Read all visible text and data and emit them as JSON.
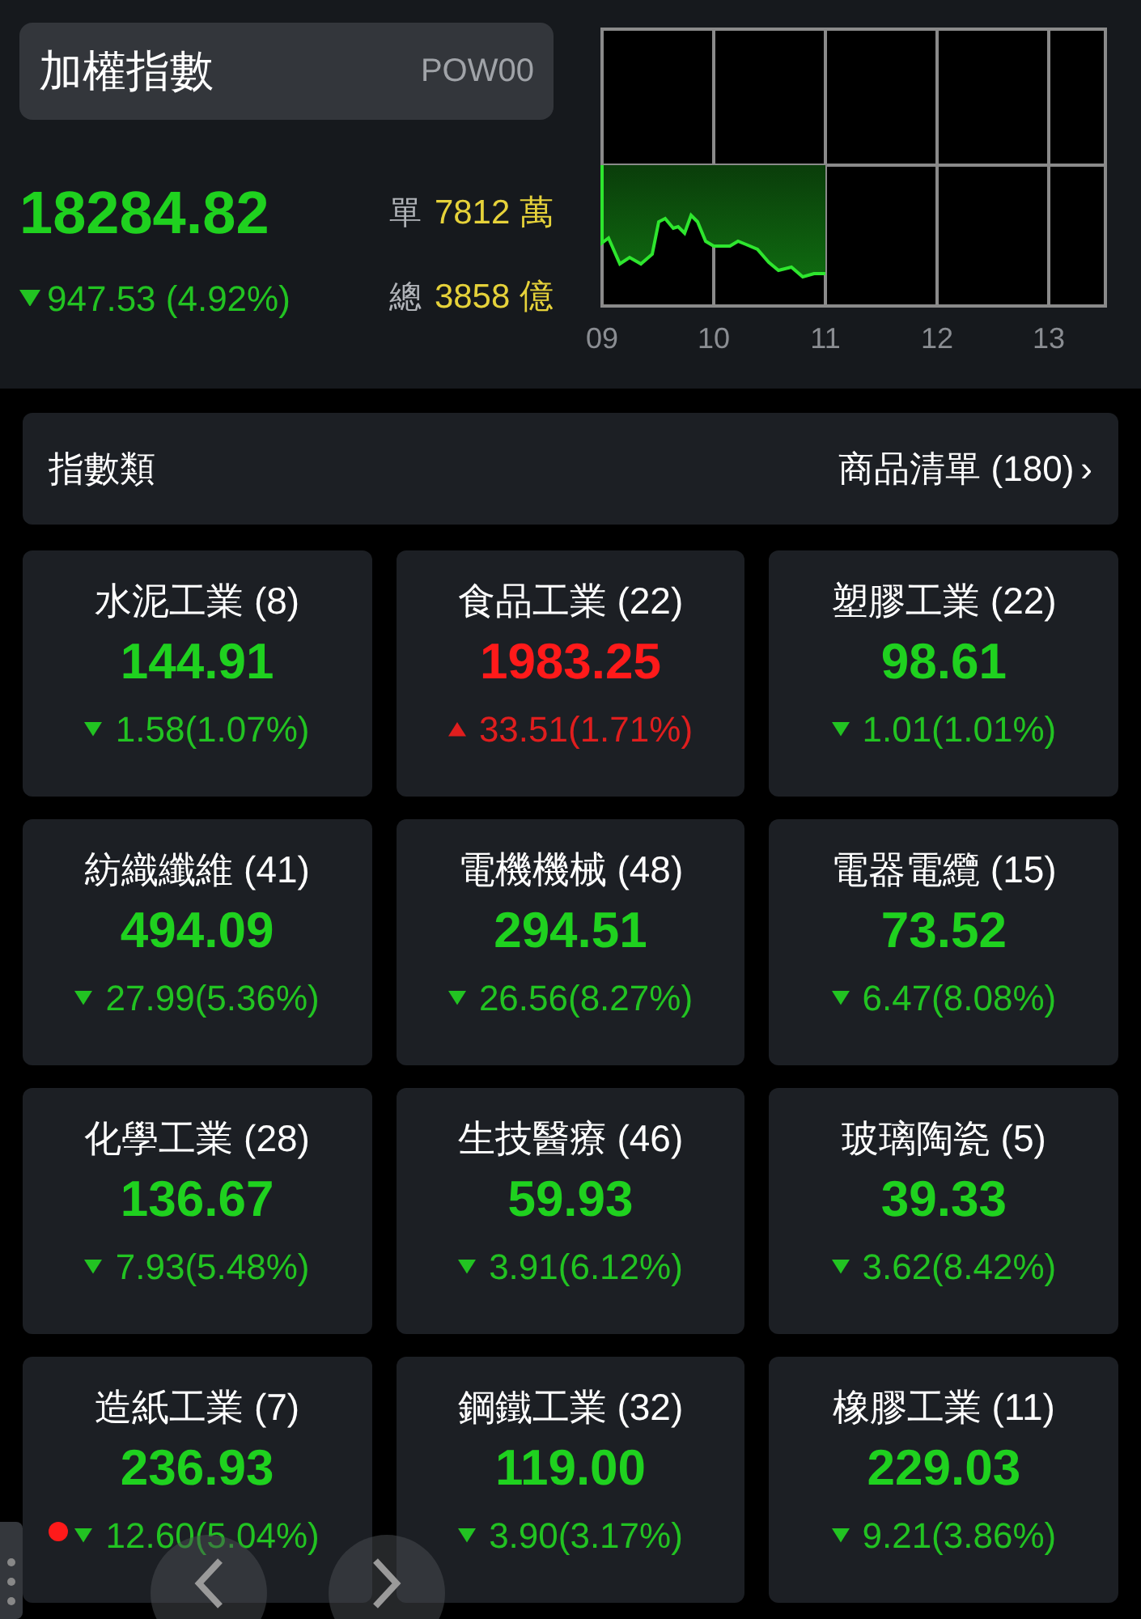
{
  "index": {
    "name": "加權指數",
    "code": "POW00",
    "price": "18284.82",
    "kind": "down",
    "change": "947.53 (4.92%)",
    "volume_label": "單",
    "volume": "7812 萬",
    "total_label": "總",
    "total": "3858 億"
  },
  "chart": {
    "time_labels": [
      "09",
      "10",
      "11",
      "12",
      "13"
    ]
  },
  "section": {
    "title": "指數類",
    "link": "商品清單 (180)",
    "link_icon": "›"
  },
  "sectors": [
    {
      "name": "水泥工業 (8)",
      "price": "144.91",
      "kind": "down",
      "change": "1.58(1.07%)"
    },
    {
      "name": "食品工業 (22)",
      "price": "1983.25",
      "kind": "up",
      "change": "33.51(1.71%)"
    },
    {
      "name": "塑膠工業 (22)",
      "price": "98.61",
      "kind": "down",
      "change": "1.01(1.01%)"
    },
    {
      "name": "紡織纖維 (41)",
      "price": "494.09",
      "kind": "down",
      "change": "27.99(5.36%)"
    },
    {
      "name": "電機機械 (48)",
      "price": "294.51",
      "kind": "down",
      "change": "26.56(8.27%)"
    },
    {
      "name": "電器電纜 (15)",
      "price": "73.52",
      "kind": "down",
      "change": "6.47(8.08%)"
    },
    {
      "name": "化學工業 (28)",
      "price": "136.67",
      "kind": "down",
      "change": "7.93(5.48%)"
    },
    {
      "name": "生技醫療 (46)",
      "price": "59.93",
      "kind": "down",
      "change": "3.91(6.12%)"
    },
    {
      "name": "玻璃陶瓷 (5)",
      "price": "39.33",
      "kind": "down",
      "change": "3.62(8.42%)"
    },
    {
      "name": "造紙工業 (7)",
      "price": "236.93",
      "kind": "down",
      "change": "12.60(5.04%)"
    },
    {
      "name": "鋼鐵工業 (32)",
      "price": "119.00",
      "kind": "down",
      "change": "3.90(3.17%)"
    },
    {
      "name": "橡膠工業 (11)",
      "price": "229.03",
      "kind": "down",
      "change": "9.21(3.86%)"
    }
  ]
}
